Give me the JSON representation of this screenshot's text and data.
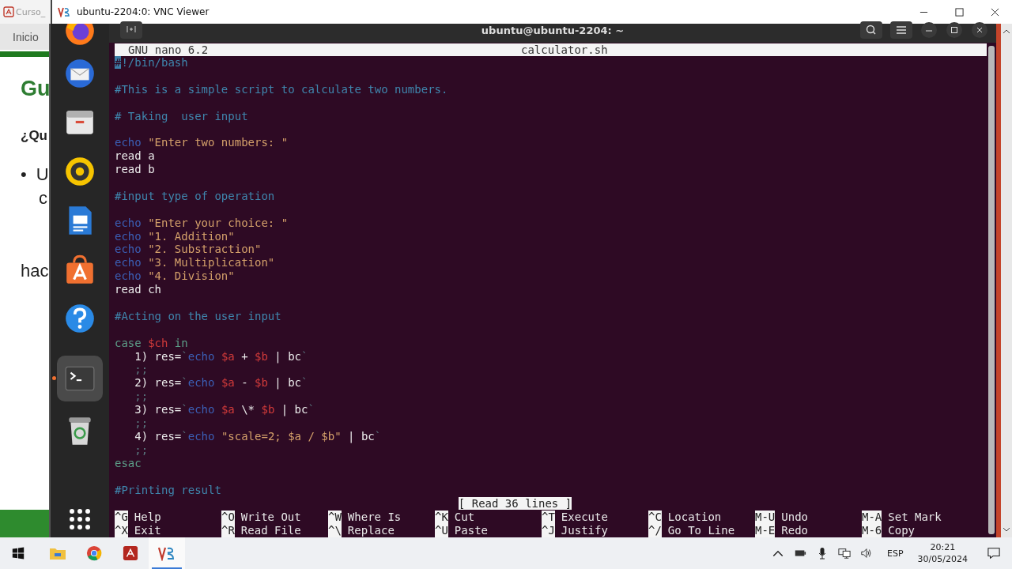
{
  "background_window": {
    "tab_title": "Curso_",
    "nav": "Inicio",
    "heading": "Gu",
    "subheading": "¿Qu",
    "bullets": [
      {
        "mark": "•",
        "text": "U"
      }
    ],
    "continuation": "c",
    "paragraph": "hac"
  },
  "window": {
    "title": "ubuntu-2204:0: VNC Viewer"
  },
  "dock": [
    {
      "kind": "firefox",
      "selected": false
    },
    {
      "kind": "mail",
      "selected": false
    },
    {
      "kind": "files",
      "selected": false
    },
    {
      "kind": "music",
      "selected": false
    },
    {
      "kind": "writer",
      "selected": false
    },
    {
      "kind": "store",
      "selected": false
    },
    {
      "kind": "help",
      "selected": false
    },
    {
      "kind": "terminal",
      "selected": true
    },
    {
      "kind": "trash",
      "selected": false
    }
  ],
  "terminal": {
    "title": "ubuntu@ubuntu-2204: ~"
  },
  "nano": {
    "version": "GNU nano 6.2",
    "filename": "calculator.sh",
    "status": "[ Read 36 lines ]",
    "lines": [
      {
        "kind": "code",
        "segments": [
          {
            "text": "#",
            "kind": "cursor"
          },
          {
            "text": "!/bin/bash",
            "kind": "comment"
          }
        ]
      },
      {
        "kind": "blank"
      },
      {
        "kind": "code",
        "segments": [
          {
            "text": "#This is a simple script to calculate two numbers.",
            "kind": "comment"
          }
        ]
      },
      {
        "kind": "blank"
      },
      {
        "kind": "code",
        "segments": [
          {
            "text": "# Taking  user input",
            "kind": "comment"
          }
        ]
      },
      {
        "kind": "blank"
      },
      {
        "kind": "code",
        "segments": [
          {
            "text": "echo",
            "kind": "keyword"
          },
          {
            "text": " \"Enter two numbers: \"",
            "kind": "string"
          }
        ]
      },
      {
        "kind": "code",
        "segments": [
          {
            "text": "read a",
            "kind": "plain"
          }
        ]
      },
      {
        "kind": "code",
        "segments": [
          {
            "text": "read b",
            "kind": "plain"
          }
        ]
      },
      {
        "kind": "blank"
      },
      {
        "kind": "code",
        "segments": [
          {
            "text": "#input type of operation",
            "kind": "comment"
          }
        ]
      },
      {
        "kind": "blank"
      },
      {
        "kind": "code",
        "segments": [
          {
            "text": "echo",
            "kind": "keyword"
          },
          {
            "text": " \"Enter your choice: \"",
            "kind": "string"
          }
        ]
      },
      {
        "kind": "code",
        "segments": [
          {
            "text": "echo",
            "kind": "keyword"
          },
          {
            "text": " \"1. Addition\"",
            "kind": "string"
          }
        ]
      },
      {
        "kind": "code",
        "segments": [
          {
            "text": "echo",
            "kind": "keyword"
          },
          {
            "text": " \"2. Substraction\"",
            "kind": "string"
          }
        ]
      },
      {
        "kind": "code",
        "segments": [
          {
            "text": "echo",
            "kind": "keyword"
          },
          {
            "text": " \"3. Multiplication\"",
            "kind": "string"
          }
        ]
      },
      {
        "kind": "code",
        "segments": [
          {
            "text": "echo",
            "kind": "keyword"
          },
          {
            "text": " \"4. Division\"",
            "kind": "string"
          }
        ]
      },
      {
        "kind": "code",
        "segments": [
          {
            "text": "read ch",
            "kind": "plain"
          }
        ]
      },
      {
        "kind": "blank"
      },
      {
        "kind": "code",
        "segments": [
          {
            "text": "#Acting on the user input",
            "kind": "comment"
          }
        ]
      },
      {
        "kind": "blank"
      },
      {
        "kind": "code",
        "segments": [
          {
            "text": "case",
            "kind": "flow"
          },
          {
            "text": " $ch",
            "kind": "variable"
          },
          {
            "text": " in",
            "kind": "flow"
          }
        ]
      },
      {
        "kind": "code",
        "segments": [
          {
            "text": "   1) res=",
            "kind": "plain"
          },
          {
            "text": "`",
            "kind": "punct"
          },
          {
            "text": "echo",
            "kind": "keyword"
          },
          {
            "text": " $a",
            "kind": "variable"
          },
          {
            "text": " + ",
            "kind": "plain"
          },
          {
            "text": "$b",
            "kind": "variable"
          },
          {
            "text": " | bc",
            "kind": "plain"
          },
          {
            "text": "`",
            "kind": "punct"
          }
        ]
      },
      {
        "kind": "code",
        "segments": [
          {
            "text": "   ;;",
            "kind": "punct"
          }
        ]
      },
      {
        "kind": "code",
        "segments": [
          {
            "text": "   2) res=",
            "kind": "plain"
          },
          {
            "text": "`",
            "kind": "punct"
          },
          {
            "text": "echo",
            "kind": "keyword"
          },
          {
            "text": " $a",
            "kind": "variable"
          },
          {
            "text": " - ",
            "kind": "plain"
          },
          {
            "text": "$b",
            "kind": "variable"
          },
          {
            "text": " | bc",
            "kind": "plain"
          },
          {
            "text": "`",
            "kind": "punct"
          }
        ]
      },
      {
        "kind": "code",
        "segments": [
          {
            "text": "   ;;",
            "kind": "punct"
          }
        ]
      },
      {
        "kind": "code",
        "segments": [
          {
            "text": "   3) res=",
            "kind": "plain"
          },
          {
            "text": "`",
            "kind": "punct"
          },
          {
            "text": "echo",
            "kind": "keyword"
          },
          {
            "text": " $a",
            "kind": "variable"
          },
          {
            "text": " \\* ",
            "kind": "plain"
          },
          {
            "text": "$b",
            "kind": "variable"
          },
          {
            "text": " | bc",
            "kind": "plain"
          },
          {
            "text": "`",
            "kind": "punct"
          }
        ]
      },
      {
        "kind": "code",
        "segments": [
          {
            "text": "   ;;",
            "kind": "punct"
          }
        ]
      },
      {
        "kind": "code",
        "segments": [
          {
            "text": "   4) res=",
            "kind": "plain"
          },
          {
            "text": "`",
            "kind": "punct"
          },
          {
            "text": "echo",
            "kind": "keyword"
          },
          {
            "text": " \"scale=2; $a / $b\"",
            "kind": "string"
          },
          {
            "text": " | bc",
            "kind": "plain"
          },
          {
            "text": "`",
            "kind": "punct"
          }
        ]
      },
      {
        "kind": "code",
        "segments": [
          {
            "text": "   ;;",
            "kind": "punct"
          }
        ]
      },
      {
        "kind": "code",
        "segments": [
          {
            "text": "esac",
            "kind": "flow"
          }
        ]
      },
      {
        "kind": "blank"
      },
      {
        "kind": "code",
        "segments": [
          {
            "text": "#Printing result",
            "kind": "comment"
          }
        ]
      }
    ],
    "shortcuts": [
      [
        {
          "key": "^G",
          "label": "Help"
        },
        {
          "key": "^X",
          "label": "Exit"
        }
      ],
      [
        {
          "key": "^O",
          "label": "Write Out"
        },
        {
          "key": "^R",
          "label": "Read File"
        }
      ],
      [
        {
          "key": "^W",
          "label": "Where Is"
        },
        {
          "key": "^\\",
          "label": "Replace"
        }
      ],
      [
        {
          "key": "^K",
          "label": "Cut"
        },
        {
          "key": "^U",
          "label": "Paste"
        }
      ],
      [
        {
          "key": "^T",
          "label": "Execute"
        },
        {
          "key": "^J",
          "label": "Justify"
        }
      ],
      [
        {
          "key": "^C",
          "label": "Location"
        },
        {
          "key": "^/",
          "label": "Go To Line"
        }
      ],
      [
        {
          "key": "M-U",
          "label": "Undo"
        },
        {
          "key": "M-E",
          "label": "Redo"
        }
      ],
      [
        {
          "key": "M-A",
          "label": "Set Mark"
        },
        {
          "key": "M-6",
          "label": "Copy"
        }
      ]
    ]
  },
  "taskbar": {
    "apps": [
      {
        "kind": "explorer",
        "selected": false
      },
      {
        "kind": "chrome",
        "selected": false
      },
      {
        "kind": "acrobat",
        "selected": false
      },
      {
        "kind": "vnc",
        "selected": true
      }
    ],
    "language": "ESP",
    "time": "20:21",
    "date": "30/05/2024"
  }
}
